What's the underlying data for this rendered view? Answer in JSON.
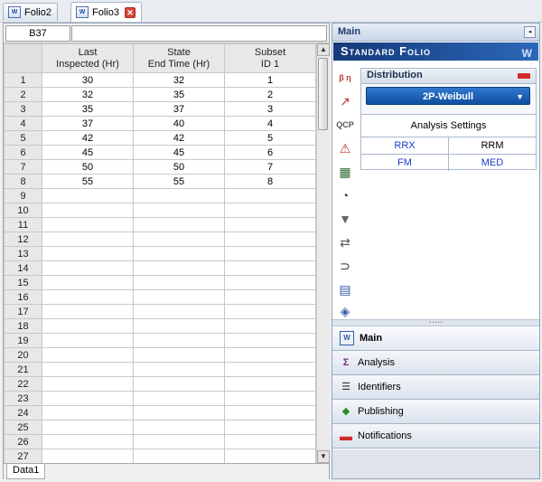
{
  "tabs": [
    {
      "label": "Folio2",
      "active": false
    },
    {
      "label": "Folio3",
      "active": true
    }
  ],
  "cellbar": {
    "ref": "B37",
    "formula": ""
  },
  "sheet": {
    "columns": [
      {
        "line1": "Last",
        "line2": "Inspected (Hr)"
      },
      {
        "line1": "State",
        "line2": "End Time (Hr)"
      },
      {
        "line1": "Subset",
        "line2": "ID 1"
      }
    ],
    "rows": [
      [
        "1",
        "30",
        "32",
        "1"
      ],
      [
        "2",
        "32",
        "35",
        "2"
      ],
      [
        "3",
        "35",
        "37",
        "3"
      ],
      [
        "4",
        "37",
        "40",
        "4"
      ],
      [
        "5",
        "42",
        "42",
        "5"
      ],
      [
        "6",
        "45",
        "45",
        "6"
      ],
      [
        "7",
        "50",
        "50",
        "7"
      ],
      [
        "8",
        "55",
        "55",
        "8"
      ],
      [
        "9",
        "",
        "",
        ""
      ],
      [
        "10",
        "",
        "",
        ""
      ],
      [
        "11",
        "",
        "",
        ""
      ],
      [
        "12",
        "",
        "",
        ""
      ],
      [
        "13",
        "",
        "",
        ""
      ],
      [
        "14",
        "",
        "",
        ""
      ],
      [
        "15",
        "",
        "",
        ""
      ],
      [
        "16",
        "",
        "",
        ""
      ],
      [
        "17",
        "",
        "",
        ""
      ],
      [
        "18",
        "",
        "",
        ""
      ],
      [
        "19",
        "",
        "",
        ""
      ],
      [
        "20",
        "",
        "",
        ""
      ],
      [
        "21",
        "",
        "",
        ""
      ],
      [
        "22",
        "",
        "",
        ""
      ],
      [
        "23",
        "",
        "",
        ""
      ],
      [
        "24",
        "",
        "",
        ""
      ],
      [
        "25",
        "",
        "",
        ""
      ],
      [
        "26",
        "",
        "",
        ""
      ],
      [
        "27",
        "",
        "",
        ""
      ]
    ],
    "sheet_tab": "Data1"
  },
  "panel": {
    "header": "Main",
    "banner": "Standard Folio",
    "distribution": {
      "label": "Distribution",
      "selected": "2P-Weibull"
    },
    "analysis": {
      "title": "Analysis Settings",
      "options": [
        "RRX",
        "RRM",
        "FM",
        "MED"
      ]
    },
    "nav": [
      "Main",
      "Analysis",
      "Identifiers",
      "Publishing",
      "Notifications"
    ]
  },
  "colors": {
    "accent": "#1c56ad",
    "link": "#1a3cc9",
    "alert": "#d22a2a"
  }
}
